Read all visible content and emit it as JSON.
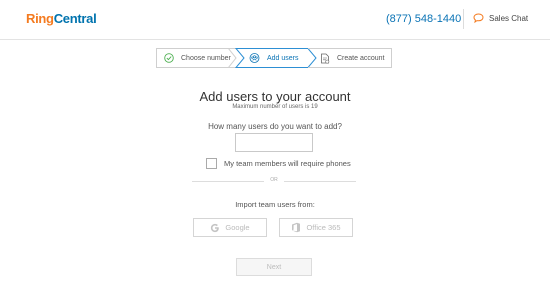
{
  "header": {
    "logo_ring": "Ring",
    "logo_central": "Central",
    "phone": "(877) 548-1440",
    "chat_label": "Sales Chat"
  },
  "steps": [
    {
      "label": "Choose number",
      "icon": "check-circle-icon",
      "state": "done"
    },
    {
      "label": "Add users",
      "icon": "users-icon",
      "state": "active"
    },
    {
      "label": "Create account",
      "icon": "document-icon",
      "state": "todo"
    }
  ],
  "main": {
    "title": "Add users to your account",
    "subtitle": "Maximum number of users is 19",
    "question": "How many users do you want to add?",
    "users_input": {
      "value": "",
      "placeholder": ""
    },
    "checkbox_label": "My team members will require phones",
    "checkbox_checked": false,
    "or_text": "OR",
    "import_label": "Import team users from:",
    "google_label": "Google",
    "office_label": "Office 365",
    "next_label": "Next"
  },
  "colors": {
    "brand_orange": "#f47b20",
    "brand_blue": "#0073ae",
    "active_step": "#0a73b5",
    "page_bg": "#ebebeb"
  }
}
